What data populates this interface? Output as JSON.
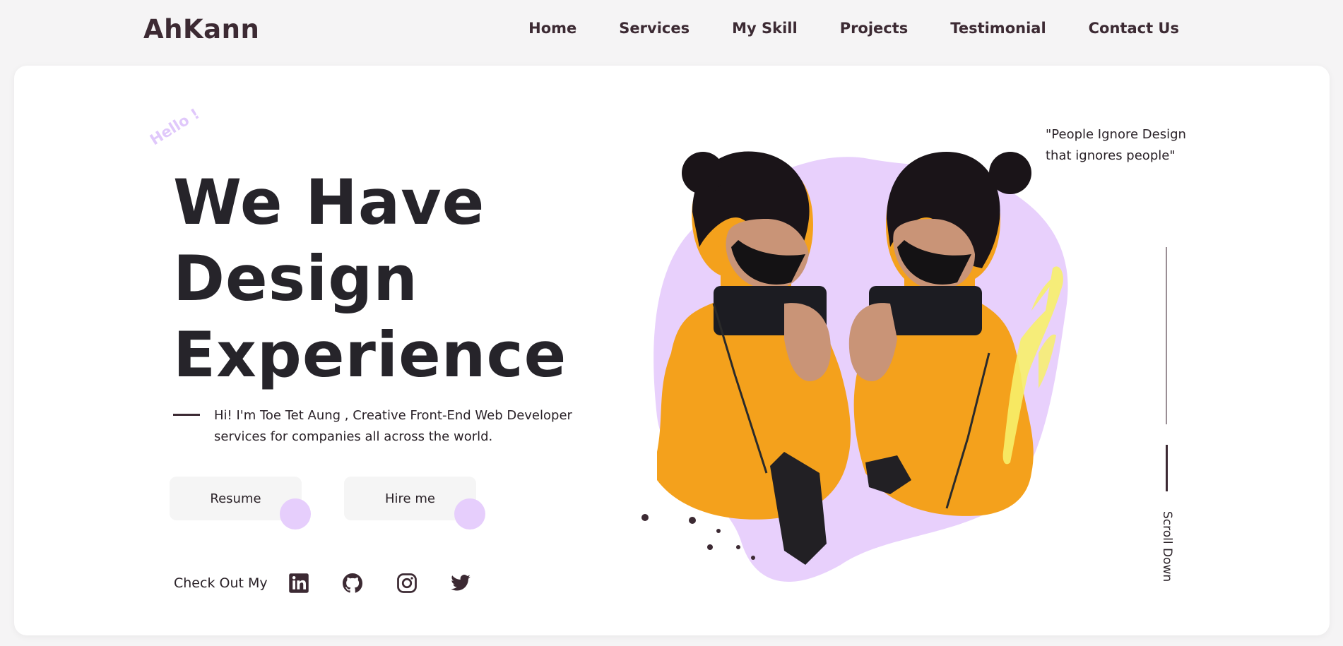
{
  "brand": {
    "logo": "AhKann"
  },
  "nav": {
    "items": [
      {
        "label": "Home"
      },
      {
        "label": "Services"
      },
      {
        "label": "My Skill"
      },
      {
        "label": "Projects"
      },
      {
        "label": "Testimonial"
      },
      {
        "label": "Contact Us"
      }
    ]
  },
  "hero": {
    "greeting": "Hello !",
    "title_lines": [
      "We Have",
      "Design",
      "Experience"
    ],
    "intro": "Hi! I'm Toe Tet Aung , Creative Front-End Web Developer services for companies all across the world.",
    "buttons": {
      "resume": "Resume",
      "hire": "Hire me"
    },
    "social_label": "Check Out My",
    "social_icons": [
      "linkedin-icon",
      "github-icon",
      "instagram-icon",
      "twitter-icon"
    ]
  },
  "quote": "\"People Ignore Design that ignores people\"",
  "scroll": {
    "label": "Scroll Down"
  },
  "colors": {
    "accent": "#e6cefc",
    "text_dark": "#26242a",
    "brand_dark": "#3c2a33",
    "shirt": "#f4a11c",
    "yellow": "#f7f06a"
  }
}
